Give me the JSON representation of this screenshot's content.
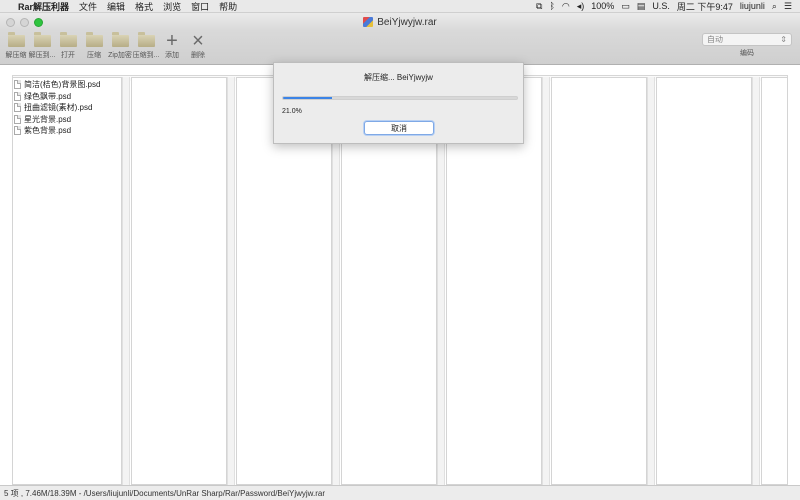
{
  "menubar": {
    "apple": "",
    "app_name": "Rar解压利器",
    "items": [
      "文件",
      "编辑",
      "格式",
      "浏览",
      "窗口",
      "帮助"
    ],
    "battery": "100%",
    "input_source": "U.S.",
    "clock": "周二 下午9:47",
    "user": "liujunli"
  },
  "window": {
    "title": "BeiYjwyjw.rar"
  },
  "toolbar": {
    "buttons": [
      {
        "label": "解压缩",
        "icon": "folder-extract-icon"
      },
      {
        "label": "解压到...",
        "icon": "folder-extract-to-icon"
      },
      {
        "label": "打开",
        "icon": "folder-open-icon"
      },
      {
        "label": "压缩",
        "icon": "folder-compress-icon"
      },
      {
        "label": "Zip加密",
        "icon": "folder-zip-encrypt-icon"
      },
      {
        "label": "压缩到...",
        "icon": "folder-compress-to-icon"
      },
      {
        "label": "添加",
        "icon": "plus-icon"
      },
      {
        "label": "删除",
        "icon": "x-icon"
      }
    ],
    "encoding_value": "自动",
    "encoding_label": "编码"
  },
  "files": [
    "简洁(桔色)背景图.psd",
    "绿色飘带.psd",
    "扭曲滤镜(素材).psd",
    "星光背景.psd",
    "紫色背景.psd"
  ],
  "dialog": {
    "title": "解压缩... BeiYjwyjw",
    "percent_text": "21.0%",
    "progress_fraction": 0.21,
    "cancel_label": "取消"
  },
  "status": {
    "text": "5 项 , 7.46M/18.39M - /Users/liujunli/Documents/UnRar Sharp/Rar/Password/BeiYjwyjw.rar"
  },
  "colors": {
    "accent": "#3c84e6",
    "zoom": "#2fc43f"
  }
}
